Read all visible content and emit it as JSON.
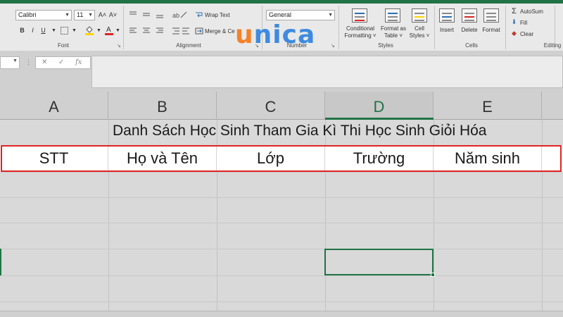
{
  "ribbon": {
    "font": {
      "name": "Calibri",
      "size": "11",
      "grow_icon": "A˄",
      "shrink_icon": "A˅",
      "bold": "B",
      "italic": "I",
      "underline": "U",
      "group_label": "Font"
    },
    "alignment": {
      "wrap_text": "Wrap Text",
      "merge_center": "Merge & Ce",
      "group_label": "Alignment"
    },
    "number": {
      "format": "General",
      "group_label": "Number"
    },
    "styles": {
      "conditional_formatting": [
        "Conditional",
        "Formatting ˅"
      ],
      "format_as_table": [
        "Format as",
        "Table ˅"
      ],
      "cell_styles": [
        "Cell",
        "Styles ˅"
      ],
      "group_label": "Styles"
    },
    "cells": {
      "insert": "Insert",
      "delete": "Delete",
      "format": "Format",
      "group_label": "Cells"
    },
    "editing": {
      "autosum": "AutoSum",
      "fill": "Fill",
      "clear": "Clear",
      "group_label": "Editing"
    }
  },
  "logo": {
    "prefix": "u",
    "rest": "nica"
  },
  "formula_bar": {
    "cancel": "✕",
    "enter": "✓",
    "fx": "fx"
  },
  "columns": [
    "A",
    "B",
    "C",
    "D",
    "E"
  ],
  "sheet": {
    "title": "Danh Sách Học Sinh Tham Gia Kì Thi Học Sinh Giỏi Hóa",
    "headers": [
      "STT",
      "Họ và Tên",
      "Lớp",
      "Trường",
      "Năm sinh"
    ]
  },
  "colors": {
    "excel_green": "#217346",
    "highlight_red": "#e02424",
    "logo_orange": "#f5822a",
    "logo_blue": "#3d8be0"
  },
  "icons": [
    "sigma-icon",
    "fill-down-icon",
    "eraser-icon",
    "paint-bucket-icon",
    "font-color-icon",
    "borders-icon"
  ]
}
